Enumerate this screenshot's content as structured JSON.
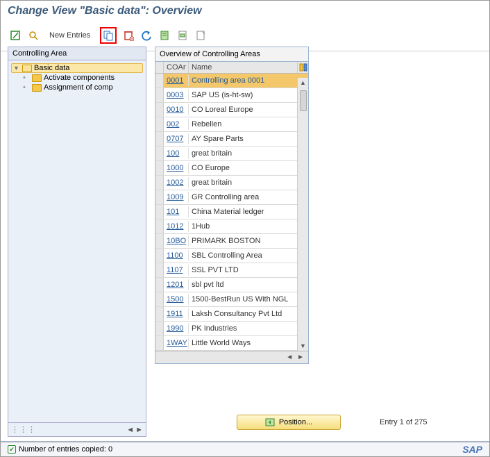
{
  "title": "Change View \"Basic data\": Overview",
  "toolbar": {
    "new_entries": "New Entries"
  },
  "sidebar": {
    "header": "Controlling Area",
    "items": [
      {
        "label": "Basic data"
      },
      {
        "label": "Activate components"
      },
      {
        "label": "Assignment of comp"
      }
    ]
  },
  "panel": {
    "title": "Overview of Controlling Areas",
    "col_coar": "COAr",
    "col_name": "Name",
    "rows": [
      {
        "co": "0001",
        "name": "Controlling area 0001",
        "sel": true
      },
      {
        "co": "0003",
        "name": "SAP US (is-ht-sw)"
      },
      {
        "co": "0010",
        "name": "CO Loreal Europe"
      },
      {
        "co": "002",
        "name": "Rebellen"
      },
      {
        "co": "0707",
        "name": "AY Spare Parts"
      },
      {
        "co": "100",
        "name": "great britain"
      },
      {
        "co": "1000",
        "name": "CO Europe"
      },
      {
        "co": "1002",
        "name": "great britain"
      },
      {
        "co": "1009",
        "name": "GR Controlling area"
      },
      {
        "co": "101",
        "name": "China Material ledger"
      },
      {
        "co": "1012",
        "name": "1Hub"
      },
      {
        "co": "10BO",
        "name": "PRIMARK BOSTON"
      },
      {
        "co": "1100",
        "name": "SBL Controlling Area"
      },
      {
        "co": "1107",
        "name": "SSL PVT LTD"
      },
      {
        "co": "1201",
        "name": "sbl pvt ltd"
      },
      {
        "co": "1500",
        "name": "1500-BestRun US With NGL"
      },
      {
        "co": "1911",
        "name": "Laksh Consultancy Pvt Ltd"
      },
      {
        "co": "1990",
        "name": "PK Industries"
      },
      {
        "co": "1WAY",
        "name": "Little World Ways"
      }
    ]
  },
  "position_btn": "Position...",
  "entry_text": "Entry 1 of 275",
  "status": "Number of entries copied: 0",
  "logo": "SAP"
}
